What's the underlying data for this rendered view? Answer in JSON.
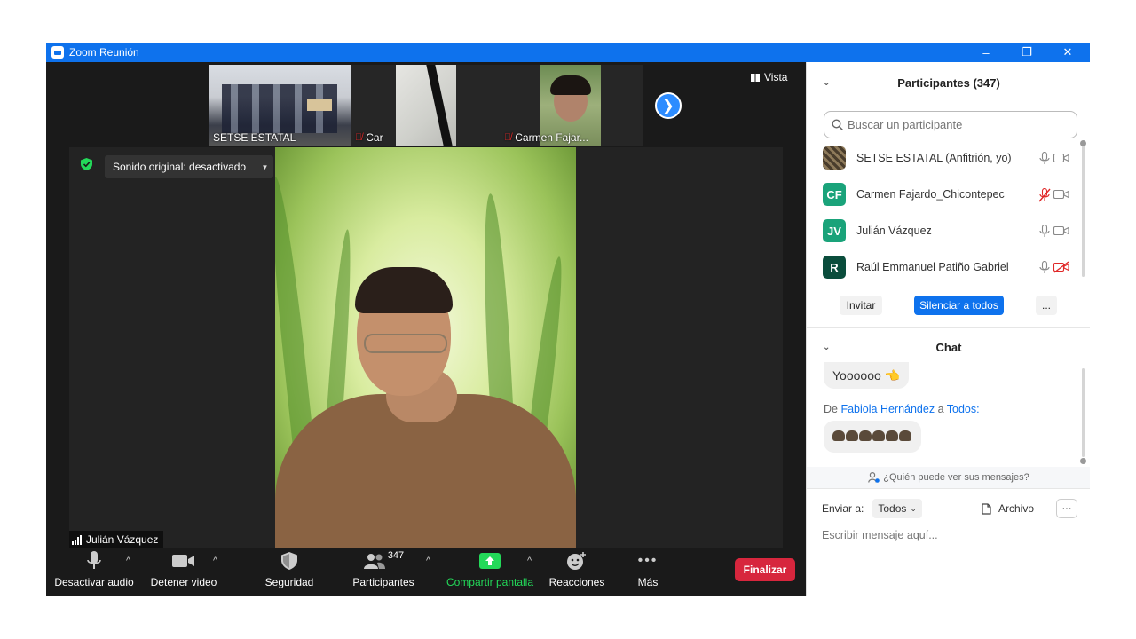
{
  "window": {
    "title": "Zoom Reunión",
    "controls": {
      "minimize": "–",
      "restore": "❐",
      "close": "✕"
    }
  },
  "thumbnails": [
    {
      "name": "SETSE ESTATAL",
      "muted": false
    },
    {
      "name": "Car",
      "muted": true
    },
    {
      "name": "Carmen Fajar...",
      "muted": true
    }
  ],
  "view": {
    "label": "Vista"
  },
  "stage": {
    "sound_original": "Sonido original: desactivado",
    "active_speaker": "Julián Vázquez"
  },
  "toolbar": {
    "mute_label": "Desactivar audio",
    "video_label": "Detener video",
    "security_label": "Seguridad",
    "participants_label": "Participantes",
    "participants_count": "347",
    "share_label": "Compartir pantalla",
    "reactions_label": "Reacciones",
    "more_label": "Más",
    "end_label": "Finalizar"
  },
  "participants_panel": {
    "title": "Participantes (347)",
    "search_placeholder": "Buscar un participante",
    "items": [
      {
        "name": "SETSE ESTATAL (Anfitrión, yo)",
        "initials": "",
        "avatar_color": "#6b5a44",
        "mic_muted": false,
        "cam_off": false
      },
      {
        "name": "Carmen Fajardo_Chicontepec",
        "initials": "CF",
        "avatar_color": "#1aa37a",
        "mic_muted": true,
        "cam_off": false
      },
      {
        "name": "Julián Vázquez",
        "initials": "JV",
        "avatar_color": "#1aa37a",
        "mic_muted": false,
        "cam_off": false
      },
      {
        "name": "Raúl Emmanuel Patiño Gabriel",
        "initials": "R",
        "avatar_color": "#0a4d3c",
        "mic_muted": false,
        "cam_off": true
      }
    ],
    "invite_label": "Invitar",
    "mute_all_label": "Silenciar a todos",
    "more_label": "..."
  },
  "chat_panel": {
    "title": "Chat",
    "messages": [
      {
        "text": "Yoooooo 👈"
      },
      {
        "from_prefix": "De",
        "from": "Fabiola Hernández",
        "to_prefix": "a",
        "to": "Todos:"
      }
    ],
    "who_can_see": "¿Quién puede ver sus mensajes?",
    "send_to_label": "Enviar a:",
    "send_to_value": "Todos",
    "file_label": "Archivo",
    "more_label": "···",
    "input_placeholder": "Escribir mensaje aquí..."
  }
}
